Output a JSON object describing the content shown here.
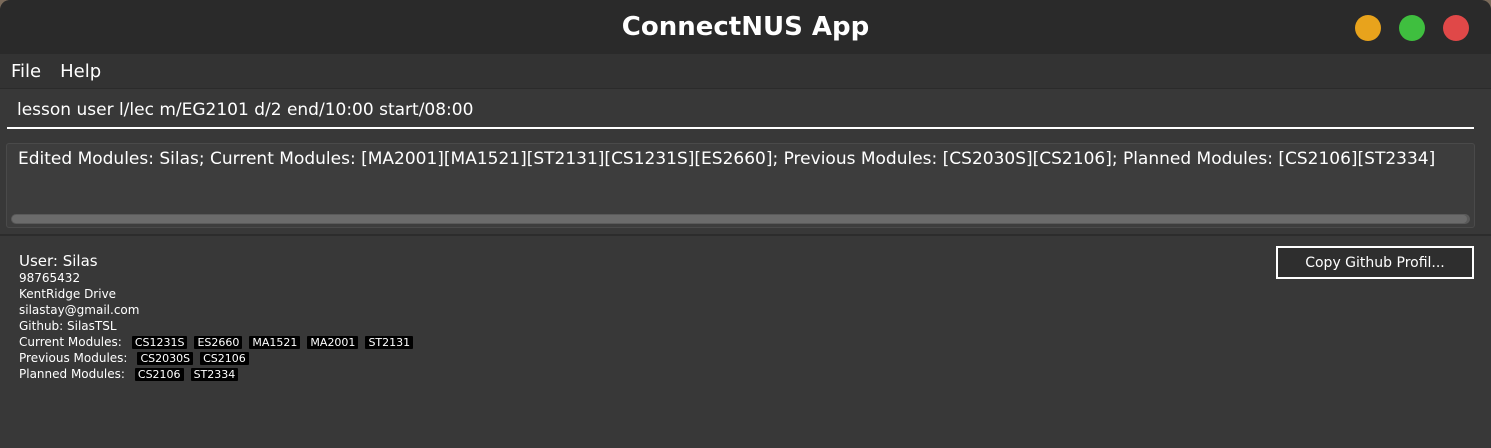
{
  "window": {
    "title": "ConnectNUS App",
    "traffic_colors": {
      "minimize": "#e8a31c",
      "maximize": "#3fbf3f",
      "close": "#e04848"
    }
  },
  "menu": {
    "items": [
      "File",
      "Help"
    ]
  },
  "command": {
    "value": "lesson user l/lec m/EG2101 d/2 end/10:00 start/08:00"
  },
  "result": {
    "text": "Edited Modules: Silas; Current Modules: [MA2001][MA1521][ST2131][CS1231S][ES2660]; Previous Modules: [CS2030S][CS2106]; Planned Modules: [CS2106][ST2334]"
  },
  "user": {
    "name_line": "User:  Silas",
    "phone": "98765432",
    "address": "KentRidge Drive",
    "email": "silastay@gmail.com",
    "github": "Github: SilasTSL",
    "current_label": "Current Modules:",
    "current_modules": [
      "CS1231S",
      "ES2660",
      "MA1521",
      "MA2001",
      "ST2131"
    ],
    "previous_label": "Previous Modules:",
    "previous_modules": [
      "CS2030S",
      "CS2106"
    ],
    "planned_label": "Planned Modules:",
    "planned_modules": [
      "CS2106",
      "ST2334"
    ],
    "copy_button_label": "Copy Github Profil..."
  }
}
